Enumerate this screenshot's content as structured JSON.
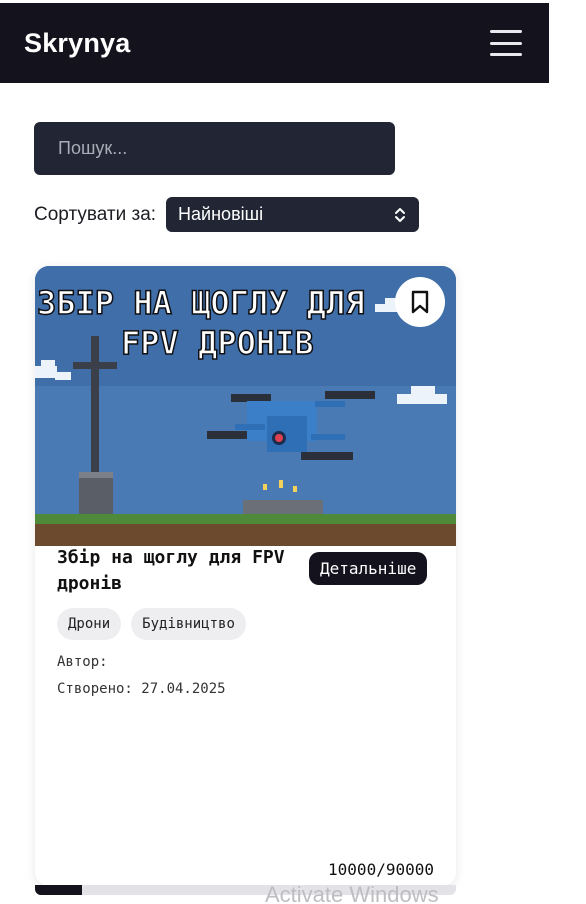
{
  "header": {
    "brand": "Skrynya",
    "menu_icon": "hamburger-menu-icon"
  },
  "search": {
    "placeholder": "Пошук..."
  },
  "sort": {
    "label": "Сортувати за:",
    "selected": "Найновіші",
    "icon": "chevron-up-down-icon"
  },
  "card": {
    "image_text_line1": "ЗБІР НА ЩОГЛУ ДЛЯ",
    "image_text_line2": "FPV ДРОНІВ",
    "bookmark_icon": "bookmark-icon",
    "title": "Збір на щоглу для FPV дронів",
    "details_label": "Детальніше",
    "tags": [
      "Дрони",
      "Будівництво"
    ],
    "author_label": "Автор:",
    "created_label": "Створено: 27.04.2025",
    "progress_text": "10000/90000",
    "progress_fraction": 0.111
  },
  "watermark": "Activate Windows",
  "colors": {
    "header_bg": "#14121c",
    "input_bg": "#222634",
    "tag_bg": "#eeeef1",
    "sky": "#4a7ab4"
  }
}
